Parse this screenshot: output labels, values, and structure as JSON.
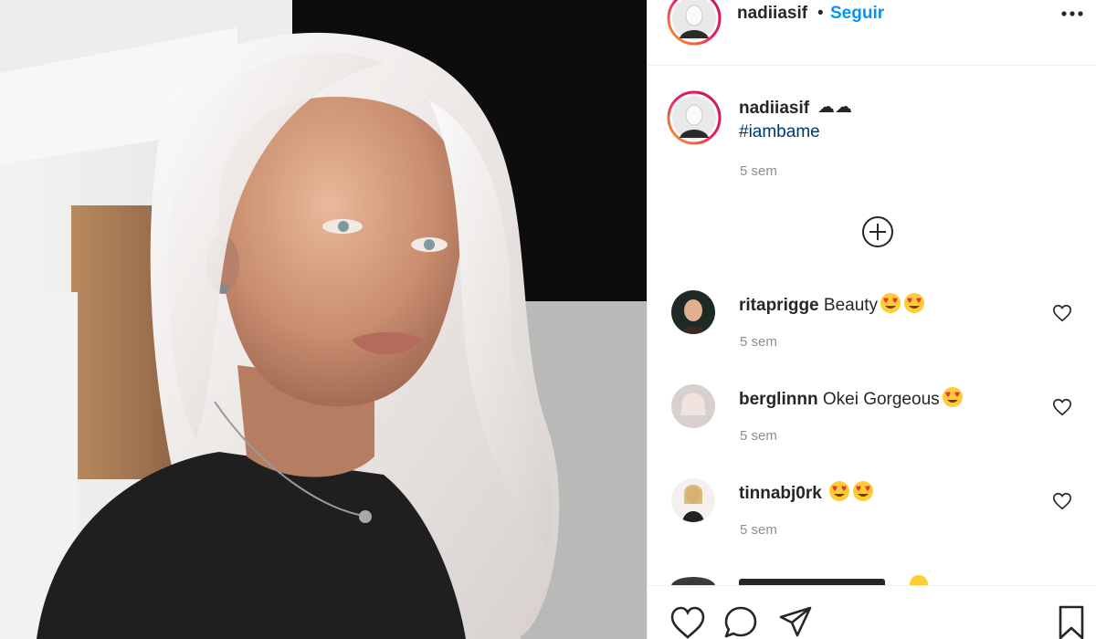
{
  "post": {
    "author": "nadiiasif",
    "separator": "•",
    "follow_label": "Seguir"
  },
  "caption": {
    "user": "nadiiasif",
    "emoji_text": "☁☁",
    "hashtag": "#iambame",
    "time": "5 sem"
  },
  "comments": [
    {
      "user": "ritaprigge",
      "text": "Beauty",
      "emojis": 2,
      "time": "5 sem"
    },
    {
      "user": "berglinnn",
      "text": "Okei Gorgeous",
      "emojis": 1,
      "time": "5 sem"
    },
    {
      "user": "tinnabj0rk",
      "text": "",
      "emojis": 2,
      "time": "5 sem"
    }
  ],
  "icons": {
    "more": "more-horizontal-icon",
    "load_more": "plus-circle-icon",
    "like": "heart-icon",
    "comment": "comment-bubble-icon",
    "share": "paper-plane-icon",
    "save": "bookmark-icon"
  },
  "colors": {
    "follow": "#0095f6",
    "hashtag": "#00376b",
    "muted": "#8e8e8e",
    "text": "#262626",
    "border": "#efefef"
  }
}
